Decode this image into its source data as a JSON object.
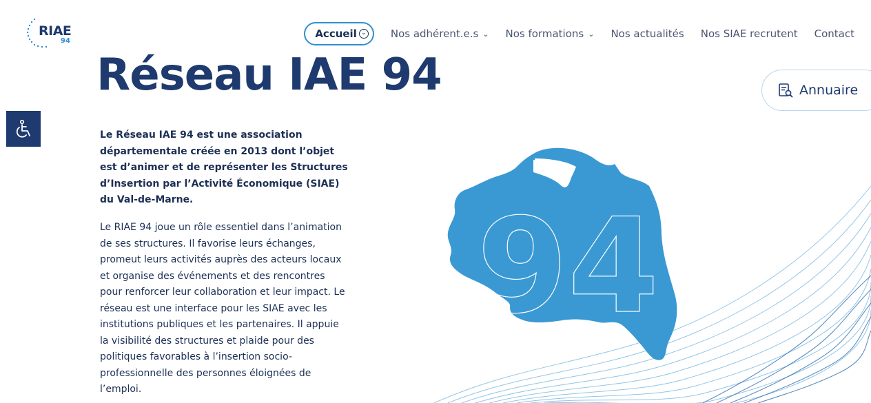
{
  "logo": {
    "text": "RIAE",
    "sub": "94"
  },
  "nav": {
    "items": [
      {
        "label": "Accueil",
        "active": true,
        "dropdown": true
      },
      {
        "label": "Nos adhérent.e.s",
        "dropdown": true
      },
      {
        "label": "Nos formations",
        "dropdown": true
      },
      {
        "label": "Nos actualités",
        "dropdown": false
      },
      {
        "label": "Nos SIAE recrutent",
        "dropdown": false
      },
      {
        "label": "Contact",
        "dropdown": false
      }
    ]
  },
  "page": {
    "title": "Réseau IAE 94",
    "annuaire_label": "Annuaire",
    "intro": "Le Réseau IAE 94 est une association départementale créée en 2013 dont l’objet est d’animer et de représenter les Structures d’Insertion par l’Activité Économique (SIAE) du Val-de-Marne.",
    "body": "Le RIAE 94 joue un rôle essentiel dans l’animation de ses structures. Il favorise leurs échanges, promeut leurs activités auprès des acteurs locaux et organise des événements et des rencontres pour renforcer leur collaboration et leur impact. Le réseau est une interface pour les SIAE avec les institutions publiques et les partenaires. Il appuie la visibilité des structures et plaide pour des politiques favorables à l’insertion socio-professionnelle des personnes éloignées de l’emploi.",
    "map_number": "94"
  },
  "icons": {
    "accessibility": "wheelchair-icon",
    "annuaire": "directory-search-icon",
    "chevron": "chevron-down-icon"
  },
  "colors": {
    "navy": "#1e3a6e",
    "blue": "#2f8fd1",
    "map": "#3a99d3"
  }
}
